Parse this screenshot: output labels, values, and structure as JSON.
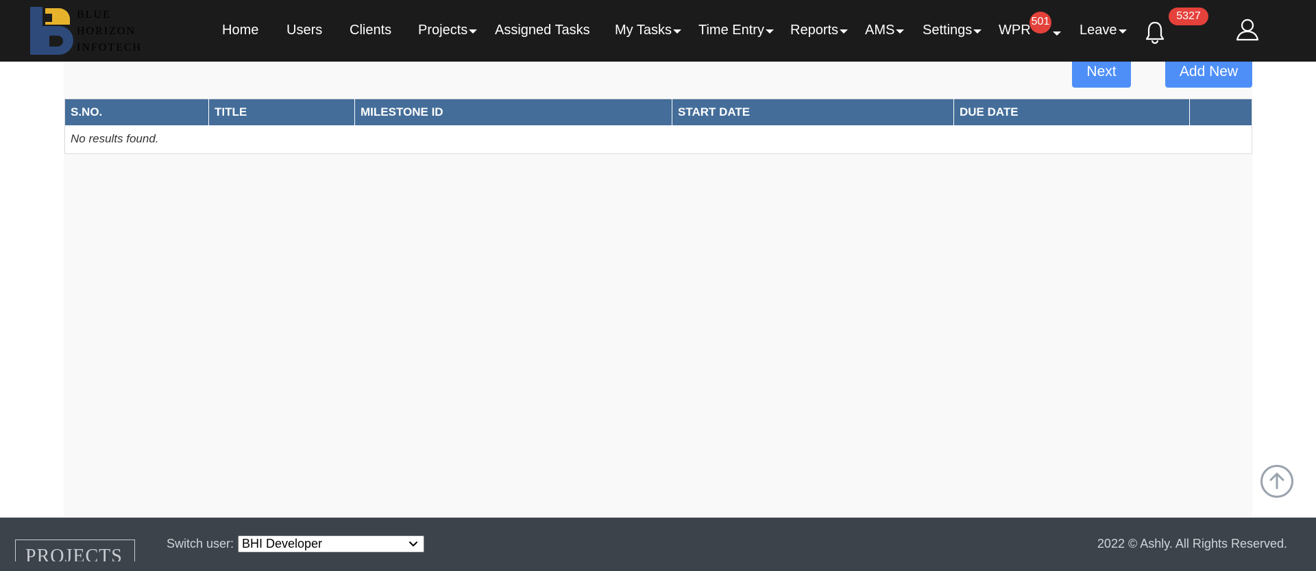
{
  "brand": {
    "logo_lines": [
      "BLUE",
      "HORIZON",
      "INFOTECH"
    ],
    "colors": {
      "mark_blue": "#2d4a7a",
      "mark_yellow": "#e8b32c"
    }
  },
  "nav": {
    "items": [
      {
        "label": "Home",
        "has_caret": false
      },
      {
        "label": "Users",
        "has_caret": false
      },
      {
        "label": "Clients",
        "has_caret": false
      },
      {
        "label": "Projects",
        "has_caret": true
      },
      {
        "label": "Assigned Tasks",
        "has_caret": false
      },
      {
        "label": "My Tasks",
        "has_caret": true
      },
      {
        "label": "Time Entry",
        "has_caret": true
      },
      {
        "label": "Reports",
        "has_caret": true
      },
      {
        "label": "AMS",
        "has_caret": true
      },
      {
        "label": "Settings",
        "has_caret": true
      },
      {
        "label": "WPR",
        "has_caret": true
      },
      {
        "label": "Leave",
        "has_caret": true
      }
    ],
    "wpr_badge": "501",
    "notifications_badge": "5327",
    "icons": {
      "notifications": "bell-icon",
      "profile": "user-icon"
    },
    "colors": {
      "bar": "#1b1b1b",
      "badge": "#e5413b"
    }
  },
  "toolbar": {
    "next_label": "Next",
    "add_new_label": "Add New",
    "button_color": "#4e8ff7"
  },
  "table": {
    "columns": [
      "S.NO.",
      "TITLE",
      "MILESTONE ID",
      "START DATE",
      "DUE DATE",
      ""
    ],
    "empty_message": "No results found.",
    "header_color": "#446d99"
  },
  "scroll_top": {
    "icon": "arrow-up-circle-icon"
  },
  "footer": {
    "logo_text": "PROJECTS",
    "switch_user_label": "Switch user:",
    "switch_user_value": "BHI Developer",
    "copyright": "2022 © Ashly. All Rights Reserved.",
    "background": "#3c434b"
  }
}
